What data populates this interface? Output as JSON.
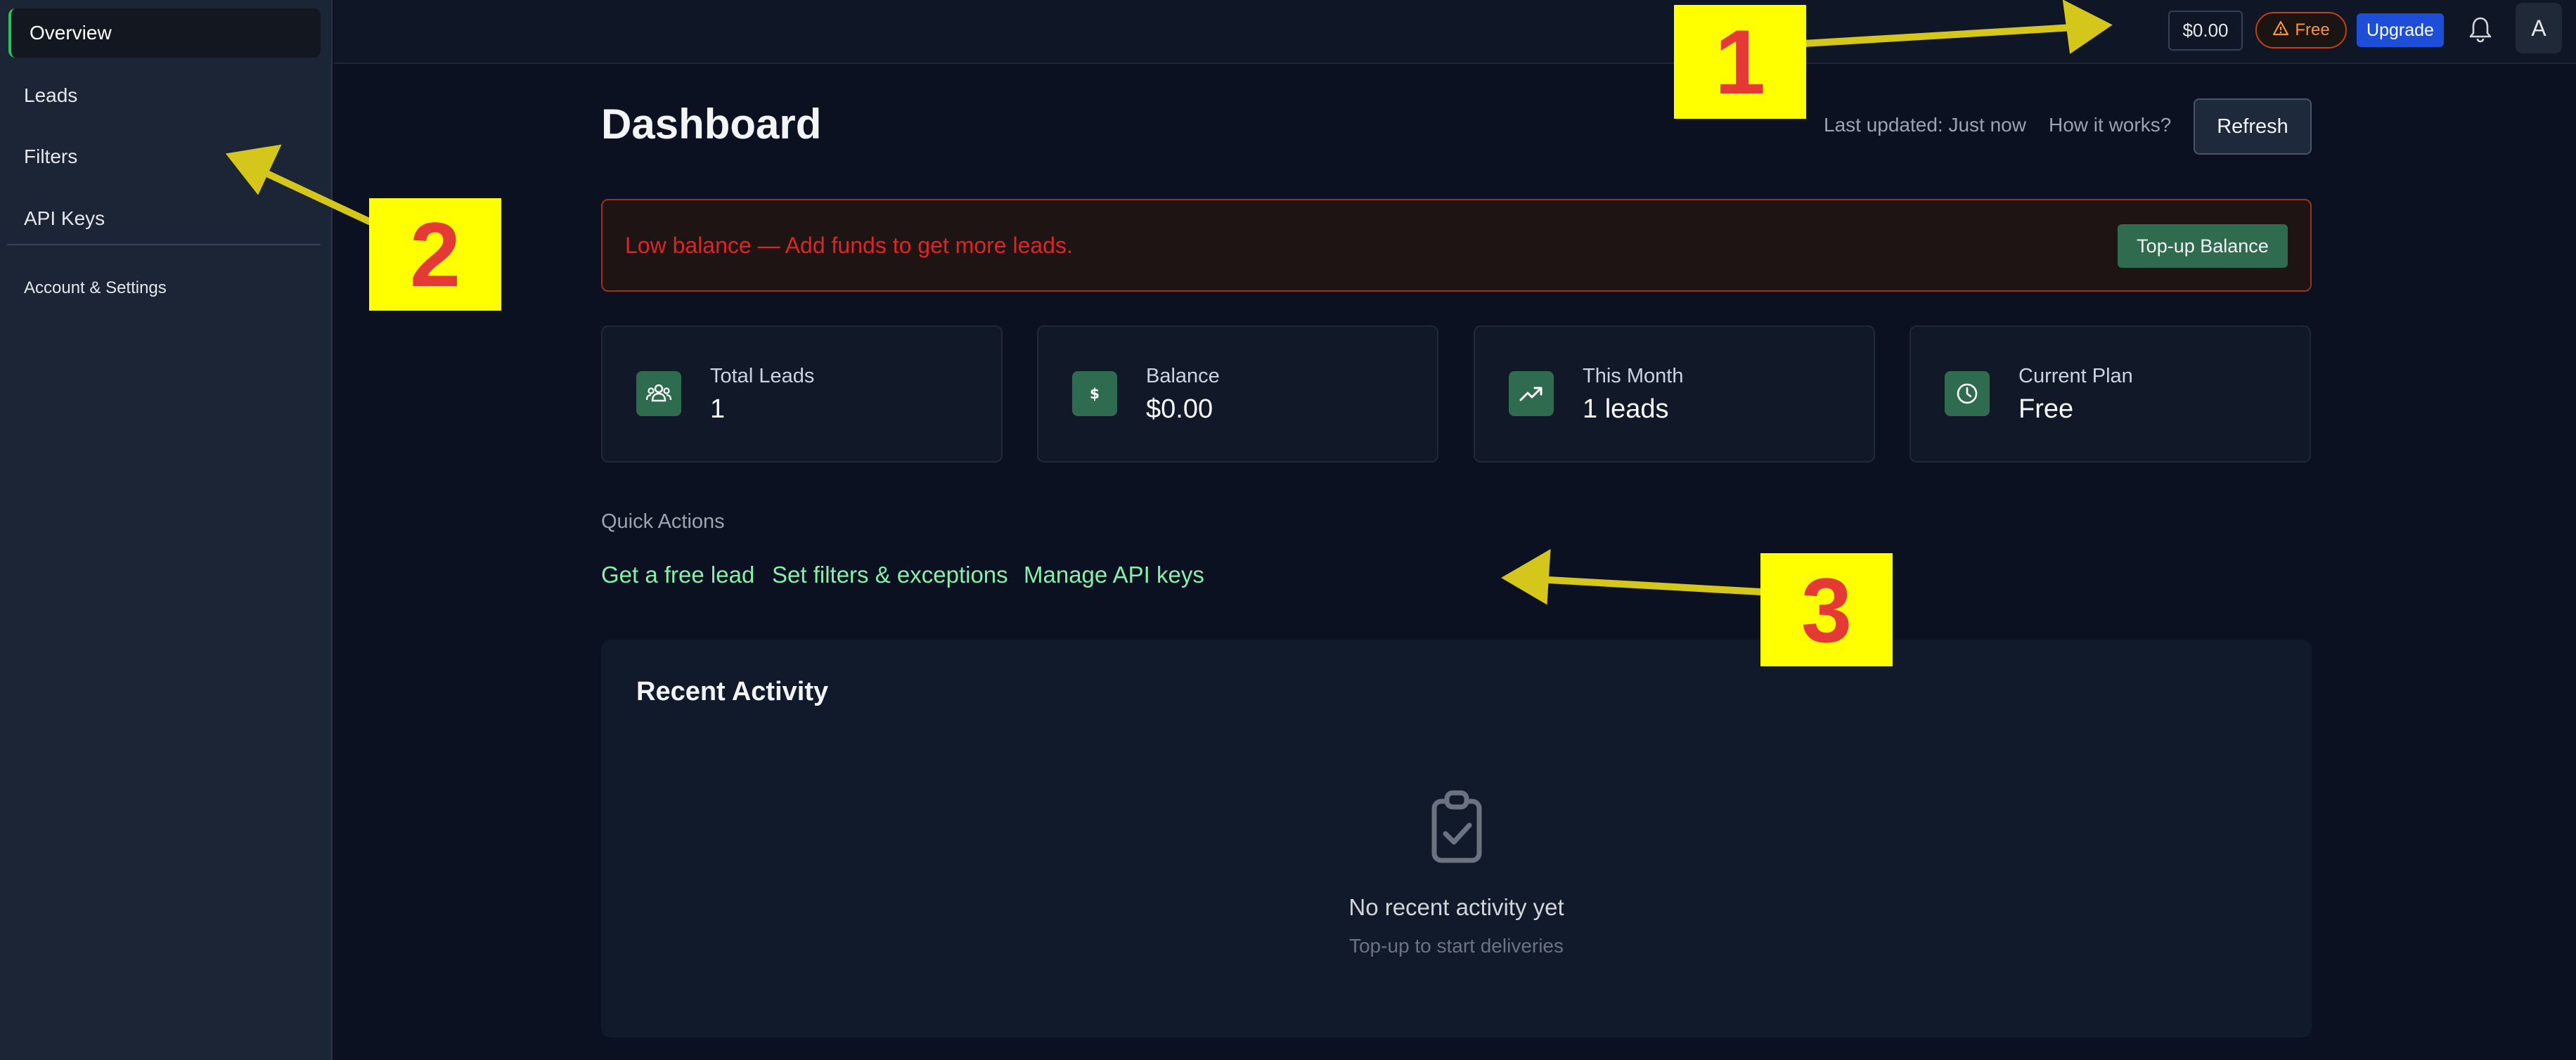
{
  "sidebar": {
    "items": [
      {
        "label": "Overview",
        "active": true
      },
      {
        "label": "Leads"
      },
      {
        "label": "Filters"
      },
      {
        "label": "API Keys"
      }
    ],
    "footer_label": "Account & Settings"
  },
  "topbar": {
    "balance": "$0.00",
    "plan_badge": "Free",
    "plan_icon": "warning-icon",
    "upgrade_label": "Upgrade",
    "notification_icon": "bell-icon",
    "avatar_initial": "A"
  },
  "header": {
    "title": "Dashboard",
    "last_updated": "Last updated: Just now",
    "help_link": "How it works?",
    "refresh_label": "Refresh"
  },
  "alert": {
    "message": "Low balance — Add funds to get more leads.",
    "action_label": "Top-up Balance"
  },
  "stats": [
    {
      "label": "Total Leads",
      "value": "1",
      "icon": "users-icon"
    },
    {
      "label": "Balance",
      "value": "$0.00",
      "icon": "dollar-icon"
    },
    {
      "label": "This Month",
      "value": "1 leads",
      "icon": "trending-up-icon"
    },
    {
      "label": "Current Plan",
      "value": "Free",
      "icon": "clock-icon"
    }
  ],
  "quick_actions": {
    "title": "Quick Actions",
    "links": [
      "Get a free lead",
      "Set filters & exceptions",
      "Manage API keys"
    ]
  },
  "recent_activity": {
    "title": "Recent Activity",
    "empty_icon": "clipboard-check-icon",
    "empty_title": "No recent activity yet",
    "empty_subtitle": "Top-up to start deliveries"
  },
  "annotations": [
    "1",
    "2",
    "3"
  ],
  "colors": {
    "accent_green": "#2f6b4f",
    "link_green": "#86efac",
    "upgrade_blue": "#1d4ed8",
    "alert_red": "#dc2626",
    "annotation_yellow": "#ffff00",
    "annotation_number": "#e53935"
  }
}
